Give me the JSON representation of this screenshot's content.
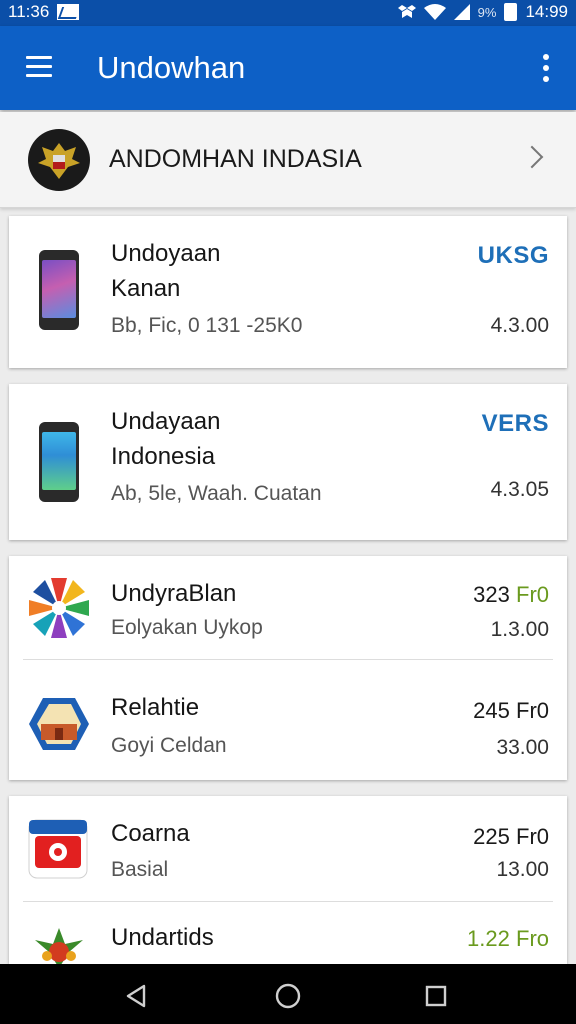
{
  "status_bar": {
    "time_left": "11:36",
    "battery_pct": "9%",
    "time_right": "14:99"
  },
  "app_bar": {
    "title": "Undowhan"
  },
  "header": {
    "title": "ANDOMHAN INDASIA"
  },
  "items": [
    {
      "line1": "Undoyaan",
      "line2": "Kanan",
      "sub": "Bb, Fic, 0 131 -25K0",
      "badge": "UKSG",
      "version": "4.3.00"
    },
    {
      "line1": "Undayaan",
      "line2": "Indonesia",
      "sub": "Ab, 5le, Waah. Cuatan",
      "badge": "VERS",
      "version": "4.3.05"
    },
    {
      "title": "UndyraBlan",
      "sub": "Eolyakan Uykop",
      "price_num": "323",
      "price_unit": "Fr0",
      "version": "1.3.00"
    },
    {
      "title": "Relahtie",
      "sub": "Goyi Celdan",
      "price_num": "245",
      "price_unit": "Fr0",
      "version": "33.00"
    },
    {
      "title": "Coarna",
      "sub": "Basial",
      "price_num": "225",
      "price_unit": "Fr0",
      "version": "13.00"
    },
    {
      "title": "Undartids",
      "price_num": "1.22",
      "price_unit": "Fro"
    }
  ],
  "colors": {
    "app_bar": "#0d60c6",
    "status_bar": "#0b4fa8",
    "badge_blue": "#1e6fb8",
    "price_green": "#6a9a1e"
  }
}
